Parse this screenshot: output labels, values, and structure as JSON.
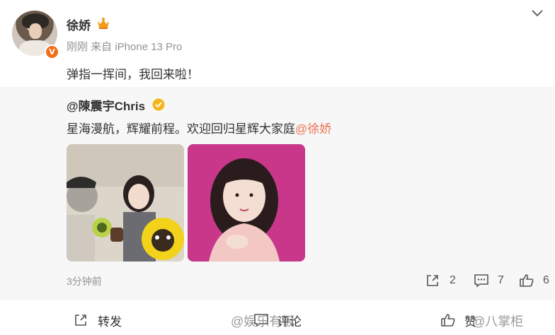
{
  "post": {
    "author": "徐娇",
    "meta": "刚刚  来自 iPhone 13 Pro",
    "text": "弹指一挥间，我回来啦！",
    "verified_badge": "V"
  },
  "repost": {
    "author": "@陳震宇Chris",
    "text_main": "星海漫航，辉耀前程。欢迎回归星辉大家庭",
    "mention": "@徐娇",
    "time": "3分钟前",
    "stats": {
      "share": "2",
      "comment": "7",
      "like": "6"
    }
  },
  "actions": {
    "forward": "转发",
    "comment": "评论",
    "like": "赞"
  },
  "watermarks": {
    "left": "@娱乐有饭",
    "right": "@八掌柜"
  },
  "colors": {
    "accent": "#eb7350",
    "badge": "#f36e18",
    "gold": "#f5b51b",
    "muted": "#939393"
  }
}
